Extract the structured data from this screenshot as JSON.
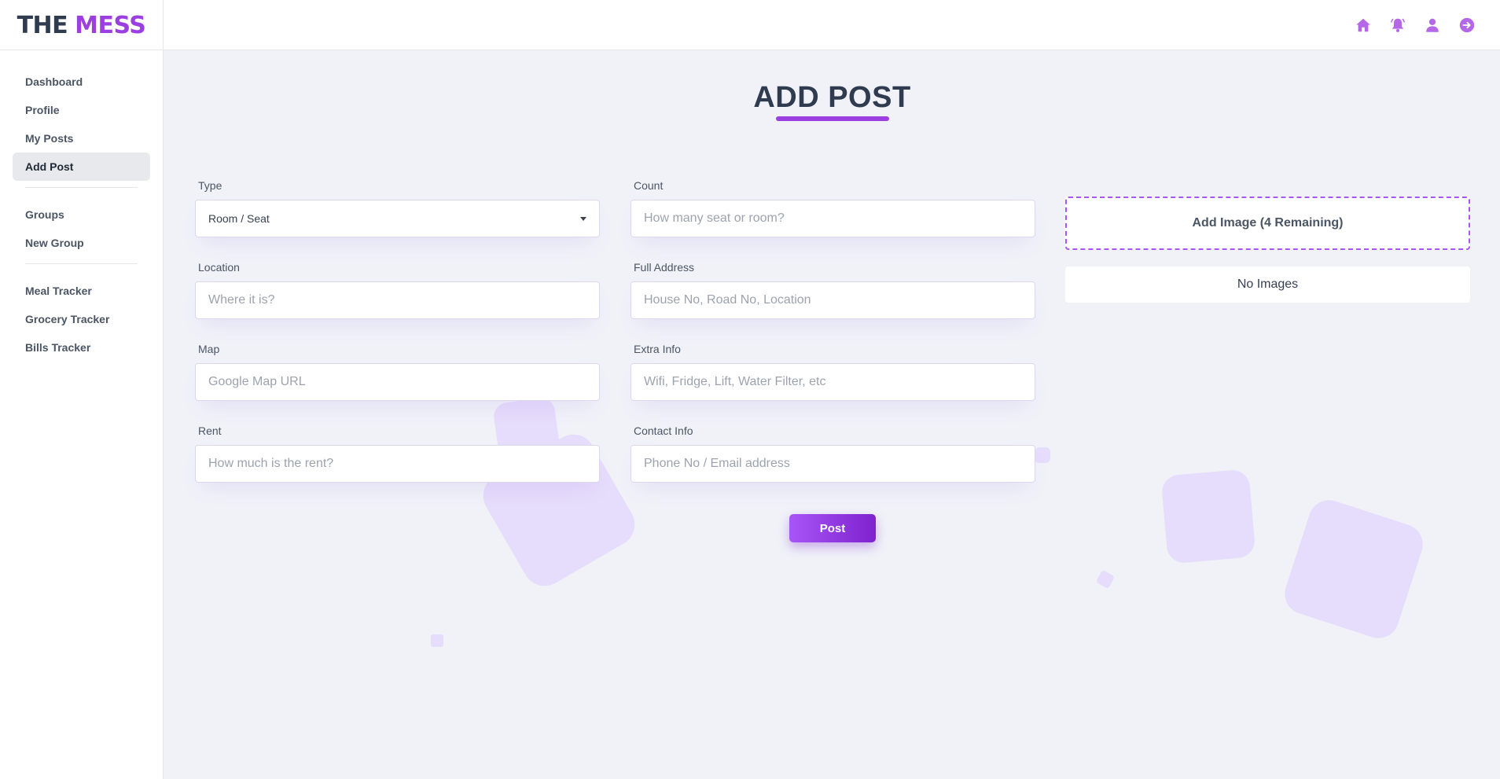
{
  "brand": {
    "part1": "THE",
    "part2": "MESS"
  },
  "header_icons": [
    "home-icon",
    "bell-icon",
    "user-icon",
    "logout-icon"
  ],
  "sidebar": {
    "items": [
      {
        "label": "Dashboard"
      },
      {
        "label": "Profile"
      },
      {
        "label": "My Posts"
      },
      {
        "label": "Add Post",
        "active": true
      },
      {
        "label": "Groups"
      },
      {
        "label": "New Group"
      },
      {
        "label": "Meal Tracker"
      },
      {
        "label": "Grocery Tracker"
      },
      {
        "label": "Bills Tracker"
      }
    ]
  },
  "page": {
    "title": "ADD POST"
  },
  "form": {
    "type": {
      "label": "Type",
      "value": "Room / Seat"
    },
    "count": {
      "label": "Count",
      "placeholder": "How many seat or room?"
    },
    "location": {
      "label": "Location",
      "placeholder": "Where it is?"
    },
    "full_address": {
      "label": "Full Address",
      "placeholder": "House No, Road No, Location"
    },
    "map": {
      "label": "Map",
      "placeholder": "Google Map URL"
    },
    "extra_info": {
      "label": "Extra Info",
      "placeholder": "Wifi, Fridge, Lift, Water Filter, etc"
    },
    "rent": {
      "label": "Rent",
      "placeholder": "How much is the rent?"
    },
    "contact_info": {
      "label": "Contact Info",
      "placeholder": "Phone No / Email address"
    },
    "submit_label": "Post"
  },
  "images": {
    "add_label": "Add Image (4 Remaining)",
    "empty_text": "No Images"
  },
  "colors": {
    "accent": "#9b3fe0",
    "button_start": "#a855f7",
    "button_end": "#7e22ce",
    "background": "#f0f2f8",
    "text_dark": "#2f3b4f"
  }
}
